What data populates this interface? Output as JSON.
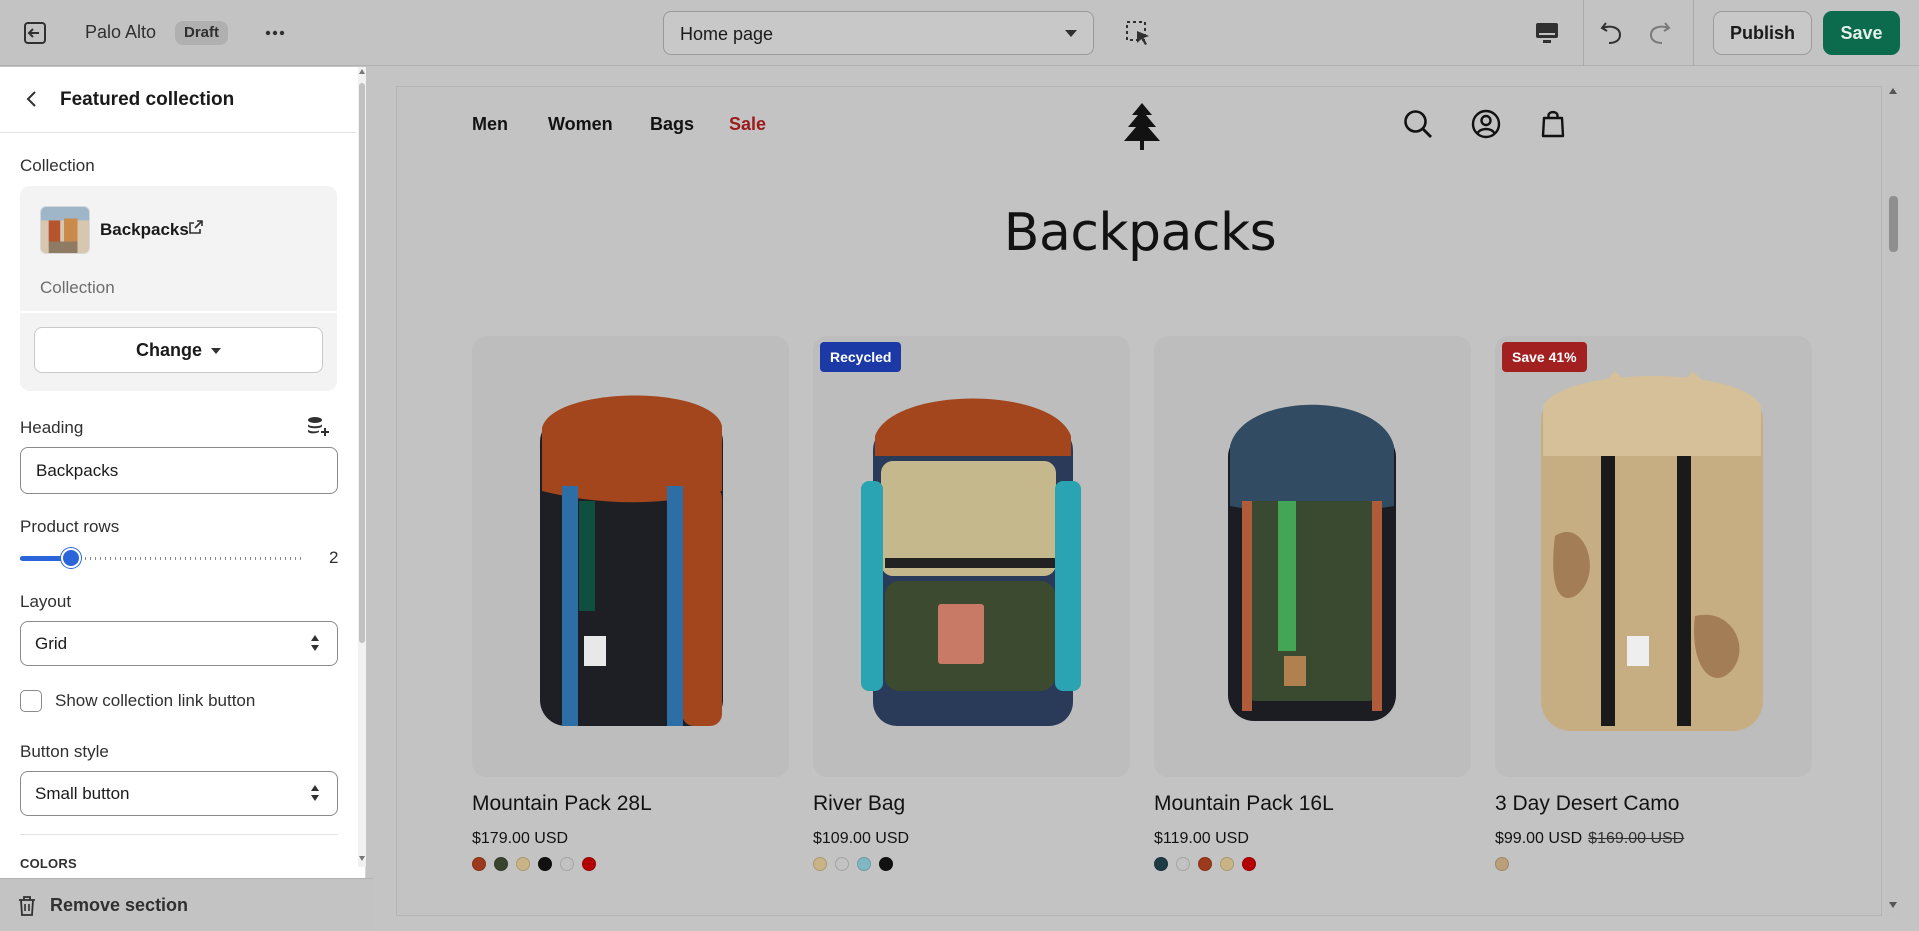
{
  "topbar": {
    "store_name": "Palo Alto",
    "status_badge": "Draft",
    "page_selector": "Home page",
    "publish_label": "Publish",
    "save_label": "Save",
    "icons": [
      "exit-icon",
      "more-icon",
      "inspect-icon",
      "desktop-icon",
      "undo-icon",
      "redo-icon"
    ]
  },
  "panel": {
    "title": "Featured collection",
    "collection_label": "Collection",
    "collection_name": "Backpacks",
    "collection_type": "Collection",
    "change_label": "Change",
    "heading_label": "Heading",
    "heading_value": "Backpacks",
    "rows_label": "Product rows",
    "rows_value": 2,
    "rows_max": 5,
    "rows_display": "2",
    "layout_label": "Layout",
    "layout_value": "Grid",
    "show_link_label": "Show collection link button",
    "show_link_checked": false,
    "button_style_label": "Button style",
    "button_style_value": "Small button",
    "colors_label": "COLORS",
    "remove_label": "Remove section"
  },
  "preview": {
    "nav": [
      {
        "label": "Men",
        "color": "#121212"
      },
      {
        "label": "Women",
        "color": "#121212"
      },
      {
        "label": "Bags",
        "color": "#121212"
      },
      {
        "label": "Sale",
        "color": "#9b1b1b"
      }
    ],
    "section_heading": "Backpacks",
    "products": [
      {
        "title": "Mountain Pack 28L",
        "price": "$179.00 USD",
        "compare_price": "",
        "badge": "",
        "badge_color": "",
        "swatches": [
          "#9c3a1c",
          "#3a4330",
          "#c9b486",
          "#111111",
          "#c2c2c2",
          "#b30000"
        ],
        "pack_colors": [
          "#a3461d",
          "#1d1f24",
          "#2e6ea6",
          "#0f4f3f"
        ]
      },
      {
        "title": "River Bag",
        "price": "$109.00 USD",
        "compare_price": "",
        "badge": "Recycled",
        "badge_color": "#1c3aa6",
        "swatches": [
          "#c9b486",
          "#c2c2c2",
          "#7fb8c2",
          "#111111"
        ],
        "pack_colors": [
          "#a3461d",
          "#c4b88c",
          "#3c4a2f",
          "#2a3b5a"
        ]
      },
      {
        "title": "Mountain Pack 16L",
        "price": "$119.00 USD",
        "compare_price": "",
        "badge": "",
        "badge_color": "",
        "swatches": [
          "#1d3a45",
          "#c2c2c2",
          "#9c3a1c",
          "#c9b486",
          "#b30000"
        ],
        "pack_colors": [
          "#304b62",
          "#3a4a30",
          "#43a656",
          "#b05c3a"
        ]
      },
      {
        "title": "3 Day Desert Camo",
        "price": "$99.00 USD",
        "compare_price": "$169.00 USD",
        "badge": "Save 41%",
        "badge_color": "#a32020",
        "swatches": [
          "#b9a07a"
        ],
        "pack_colors": [
          "#c7ad82",
          "#d5c09a",
          "#1a1a1a",
          "#a37d55"
        ]
      }
    ],
    "header_icons": [
      "search-icon",
      "account-icon",
      "cart-icon"
    ]
  }
}
